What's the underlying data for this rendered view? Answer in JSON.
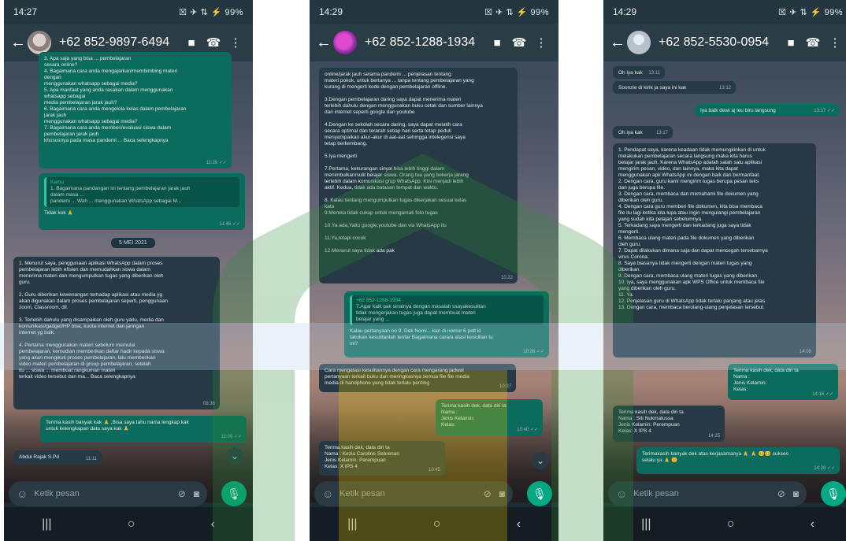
{
  "phones": [
    {
      "status": {
        "time": "14:27",
        "left_icons": "▲ ▢",
        "right": "☒ ✈ ⇅ ⚡ 99%"
      },
      "contact": "+62 852-9897-6494",
      "messages": [
        {
          "lines": [
            "3. Apa saja yang bisa ... pembelajaran",
            "secara online?",
            "4. Bagaimana cara anda mengajarkan/membimbing materi",
            "dengan",
            "menggunakan whatsapp sebagai media?",
            "5. Apa manfaat yang anda rasakan dalam menggunakan",
            "whatsapp sebagai",
            "media pembelajaran jarak jauh?",
            "6. Bagaimana cara anda mengelola kelas dalam pembelajaran",
            "jarak jauh",
            "menggunakan whatsapp sebagai media?",
            "7. Bagaimana cara anda memberi/evaluasi siswa dalam",
            "pembelajaran jarak jauh",
            "khususnya pada masa pandemi ... Baca selengkapnya"
          ],
          "time": "11:26 ✓✓"
        },
        {
          "quote": {
            "name": "Kamu",
            "lines": [
              "1. Bagaimana pandangan ini tentang pembelajaran jarak jauh",
              "dalam masa ...",
              "pandemi ... Wah ... menggunakan WhatsApp sebagai M..."
            ]
          },
          "lines": [
            "Tidak kok 🙏"
          ],
          "time": "11:46 ✓✓"
        }
      ],
      "date_chip": "5 MEI 2021",
      "messages_b": [
        {
          "lines": [
            "1. Menurut saya, penggunaan aplikasi WhatsApp dalam proses",
            "pembelajaran lebih efisien dan memudahkan siswa dalam",
            "menerima materi dan mengumpulkan tugas yang diberikan oleh",
            "guru.",
            "",
            "2. Guru diberikan kewenangan terhadap aplikasi atau media yg",
            "akan digunakan dalam proses pembelajaran seperti, penggunaan",
            "zoom, Classroom, dll.",
            "",
            "3. Terlebih dahulu yang disampaikan oleh guru yaitu, media dan",
            "komunikasi/gadget/HP bisa, kuota internet dan jaringan",
            "internet yg baik.",
            "",
            "4. Pertama menggunakan materi sebelum memulai",
            "pembelajaran, kemudian memberikan daftar hadir kepada siswa",
            "yang akan mengikuti proses pembelajaran, lalu memberikan",
            "video materi pembelajaran di group pembelajaran, setelah",
            "itu ... siswa ... membuat rangkuman materi",
            "terkait video tersebut dan ma... Baca selengkapnya"
          ],
          "time": "08:36"
        },
        {
          "lines": [
            "Terima kasih banyak kak 🙏 ,Bisa saya tahu nama lengkap kak",
            "untuk kelengkapan data saya kak 🙏"
          ],
          "time": "11:09 ✓✓"
        },
        {
          "lines": [
            "Abdul Rajak S.Pd"
          ],
          "time": "11:11"
        }
      ],
      "input": {
        "placeholder": "Ketik pesan"
      }
    },
    {
      "status": {
        "time": "14:29",
        "left_icons": "▲ ▢ ▭",
        "right": "☒ ✈ ⇅ ⚡ 99%"
      },
      "contact": "+62 852-1288-1934",
      "messages": [
        {
          "lines": [
            "online/jarak jauh selama pandemi ... penjelasan tentang",
            "materi pokok, untuk bertanya ... tanpa tentang pembelajaran yang",
            "kurang di mengerti kode dengan pembelajaran offline.",
            "",
            "3.Dengan pembelajaran daring saya dapat menerima materi",
            "terlebih dahulu dengan menggunakan buku cetak dan sumber lainnya",
            "dari internet seperti google dan youtube",
            "",
            "4.Dengan ke sekolah secara daring, saya dapat melatih cara",
            "secara optimal dan terarah setiap hari serta tetap peduli",
            "menyampaikan akur-akur di aat-aat sehingga intelegensi saya",
            "tetap berkembang.",
            "",
            "5.Iya mengerti",
            "",
            "7.Pertama, kekurangan sinyal bisa lebih tinggi dalam",
            "menimbulkan/sulit belajar siswa. Orang tua yang bekerja jarang",
            "terlebih dalam komunikasi grup WhatsApp. Kini menjadi lebih",
            "aktif. Kedua, tidak ada batasan tempat dan waktu.",
            "",
            "8. Kalau tentang mengumpulkan tugas dikerjakan sesuai kelas",
            "kata",
            "9.Mereka tidak cukup untuk mengamati foto tugas",
            "",
            "10.Ya ada,Yaitu google,youtube dan via WhatsApp itu",
            "",
            "11.Ya,tetapi cocok",
            "",
            "12.Menurut saya tidak ada pak"
          ],
          "time": "10:22"
        },
        {
          "quote": {
            "name": "+62 852-1288-1934",
            "lines": [
              "7.Agar kalit pak sinalnya dengan masalah ssayakesulitan",
              "tidak mengerjakan tugas juga dapat membuat materi",
              "belajar yang ..."
            ]
          },
          "lines": [
            "Kalau pertanyaan no 9, Dek Nomi... kan di nomor 6 pelt ki",
            "lakukan kesulitanlah tentar Bagaimana cara/a atasi kesulitan tu",
            "ini?"
          ],
          "time": "10:38 ✓✓"
        },
        {
          "lines": [
            "Cara mengatasi kesulitannya dengan cara mengarang jadwal",
            "pertanyaan terkait buku dan meringkasnya semua file file media",
            "media di handphone yang tidak terlalu penting"
          ],
          "time": "10:37"
        },
        {
          "lines": [
            "Terima kasih dek, data diri ta",
            "Nama :",
            "Jenis Kelamin:",
            "Kelas:"
          ],
          "time": "10:40 ✓✓"
        },
        {
          "lines": [
            "Terima kasih dek, data diri ta",
            "Nama : Kezia Caroline Sebrenan",
            "Jenis Kelamin: Perempuan",
            "Kelas: X IPS 4"
          ],
          "time": "10:45"
        }
      ],
      "input": {
        "placeholder": "Ketik pesan"
      }
    },
    {
      "status": {
        "time": "14:29",
        "left_icons": "▲ ▢ ▭",
        "right": "☒ ✈ ⇅ ⚡ 99%"
      },
      "contact": "+62 852-5530-0954",
      "messages": [
        {
          "lines": [
            "Oh iya kak"
          ],
          "time": "13:11"
        },
        {
          "lines": [
            "Soonzie di kirik ja saya ini kak"
          ],
          "time": "13:12"
        },
        {
          "lines": [
            "Iya baik dewi aj leu biru langsung"
          ],
          "time": "13:17 ✓✓"
        },
        {
          "lines": [
            "Oh iya kak"
          ],
          "time": "13:17"
        },
        {
          "lines": [
            "1. Pendapat saya, karena keadaan tidak memungkinkan di untuk",
            "melakukan pembelajaran secara langsung maka kita harus",
            "belajar jarak jauh. Karena WhatsApp adalah salah satu aplikasi",
            "mengirim pesan, video, dan lainnya, maka kita dapat",
            "menggunakan apk WhatsApp ini dengan baik dan bermanfaat.",
            "2. Dengan cara, guru kami mengirim tugas berupa pesan teks",
            "dan juga berupa file.",
            "3. Dengan cara, membaca dan memahami file dokumen yang",
            "diberikan oleh guru.",
            "4. Dengan cara guru memberi file dokumen, kita bisa membaca",
            "file itu lagi ketika kita lupa atau ingin mengulangi pembelajaran",
            "yang sudah kita pelajari sebelumnya.",
            "5. Terkadang saya mengerti dan terkadang juga saya tidak",
            "mengerti.",
            "6. Membaca ulang materi pada file dokumen yang diberikan",
            "oleh guru.",
            "7. Dapat dilakukan dimana saja dan dapat mencegah tersebarnya",
            "virus Corona.",
            "8. Saya biasanya tidak mengerti dengan materi tugas yang",
            "diberikan.",
            "9. Dengan cara, membaca ulang materi tugas yang diberikan.",
            "10. Iya, saya menggunakan apk WPS Office untuk membaca file",
            "yang diberikan oleh guru.",
            "11. Ya.",
            "12. Penjelasan guru di WhatsApp tidak terlalu panjang atau jelas.",
            "13. Dengan cara, membaca berulang-ulang penjelasan tersebut."
          ],
          "time": "14:09"
        },
        {
          "lines": [
            "Terima kasih dek, data diri ta",
            "Nama :",
            "Jenis Kelamin:",
            "Kelas:"
          ],
          "time": "14:16 ✓✓"
        },
        {
          "lines": [
            "Terima kasih dek, data diri ta",
            "Nama : Siti Nukmatussa",
            "Jenis Kelamin: Perempuan",
            "Kelas: X IPS 4"
          ],
          "time": "14:25"
        },
        {
          "lines": [
            "Terimakasih banyak dek atas kerjasamanya 🙏 🙏 😊😊 sukses",
            "selalu ya 🙏 😊"
          ],
          "time": "14:28 ✓✓"
        }
      ],
      "input": {
        "placeholder": "Ketik pesan"
      }
    }
  ],
  "icons": {
    "back": "←",
    "video": "■",
    "call": "☎",
    "menu": "⋮",
    "emoji": "☺",
    "attach": "⊘",
    "camera": "◙",
    "mic": "🎙",
    "nav_recents": "|||",
    "nav_home": "○",
    "nav_back": "‹",
    "scroll_down": "⌄"
  },
  "colors": {
    "accent": "#00a884",
    "outgoing": "#0b6b5c",
    "incoming": "#263945",
    "header": "#2a3c46",
    "watermark_green": "#2e8b3a",
    "watermark_yellow": "#e8c400"
  }
}
